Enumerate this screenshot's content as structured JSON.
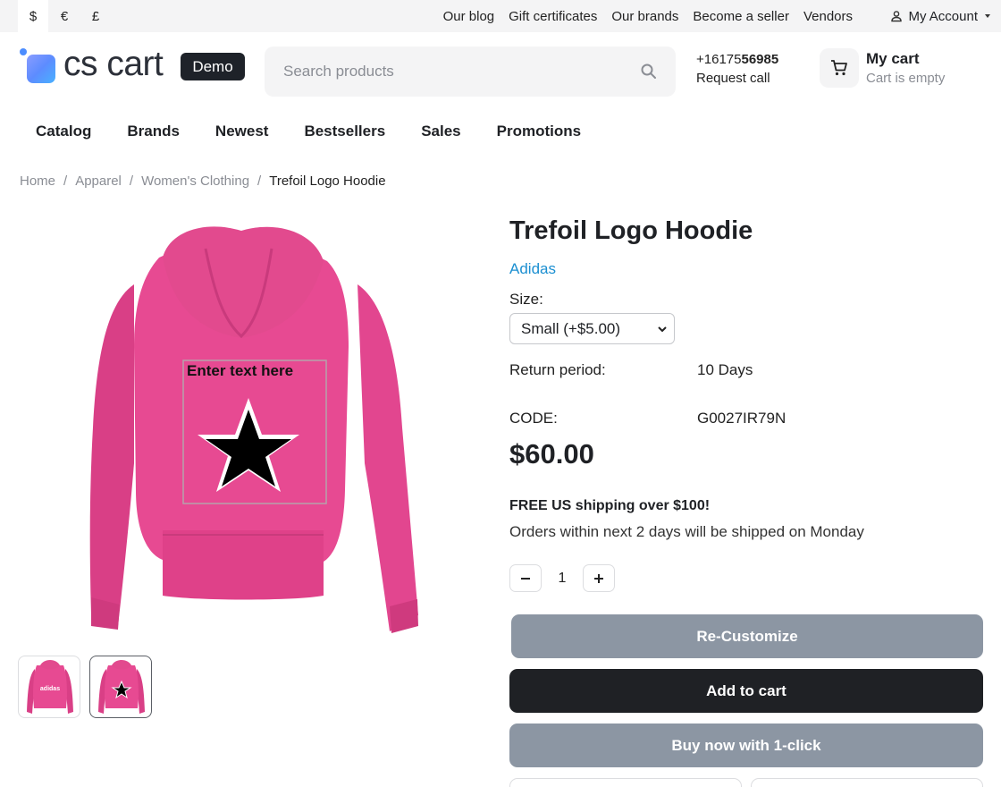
{
  "topbar": {
    "currencies": [
      "$",
      "€",
      "£"
    ],
    "links": [
      "Our blog",
      "Gift certificates",
      "Our brands",
      "Become a seller",
      "Vendors"
    ],
    "account_label": "My Account"
  },
  "header": {
    "logo_text": "cs cart",
    "logo_badge": "Demo",
    "search_placeholder": "Search products",
    "phone_prefix": "+16175",
    "phone_bold": "56985",
    "request_call": "Request call",
    "cart_title": "My cart",
    "cart_status": "Cart is empty"
  },
  "nav": [
    "Catalog",
    "Brands",
    "Newest",
    "Bestsellers",
    "Sales",
    "Promotions"
  ],
  "breadcrumb": {
    "links": [
      "Home",
      "Apparel",
      "Women's Clothing"
    ],
    "current": "Trefoil Logo Hoodie"
  },
  "product": {
    "title": "Trefoil Logo Hoodie",
    "brand": "Adidas",
    "size_label": "Size:",
    "size_selected": "Small (+$5.00)",
    "return_label": "Return period:",
    "return_value": "10 Days",
    "code_label": "CODE:",
    "code_value": "G0027IR79N",
    "price": "$60.00",
    "shipping_promo": "FREE US shipping over $100!",
    "shipping_note": "Orders within next 2 days will be shipped on Monday",
    "quantity": "1",
    "image_text": "Enter text here",
    "thumb1_text": "adidas",
    "colors": {
      "hoodie": "#e24a8e",
      "link": "#1b8fd1",
      "button_gray": "#8c96a3",
      "button_dark": "#1f2125"
    }
  },
  "buttons": {
    "recustomize": "Re-Customize",
    "add_to_cart": "Add to cart",
    "buy_one_click": "Buy now with 1-click"
  }
}
